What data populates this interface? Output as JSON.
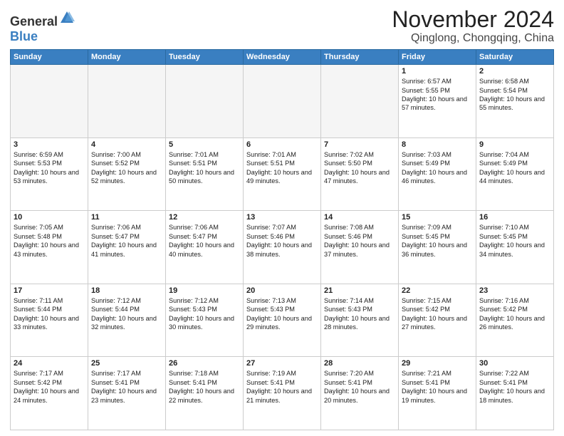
{
  "logo": {
    "general": "General",
    "blue": "Blue"
  },
  "title": "November 2024",
  "location": "Qinglong, Chongqing, China",
  "days_header": [
    "Sunday",
    "Monday",
    "Tuesday",
    "Wednesday",
    "Thursday",
    "Friday",
    "Saturday"
  ],
  "weeks": [
    [
      {
        "day": "",
        "empty": true
      },
      {
        "day": "",
        "empty": true
      },
      {
        "day": "",
        "empty": true
      },
      {
        "day": "",
        "empty": true
      },
      {
        "day": "",
        "empty": true
      },
      {
        "day": "1",
        "text": "Sunrise: 6:57 AM\nSunset: 5:55 PM\nDaylight: 10 hours and 57 minutes."
      },
      {
        "day": "2",
        "text": "Sunrise: 6:58 AM\nSunset: 5:54 PM\nDaylight: 10 hours and 55 minutes."
      }
    ],
    [
      {
        "day": "3",
        "text": "Sunrise: 6:59 AM\nSunset: 5:53 PM\nDaylight: 10 hours and 53 minutes."
      },
      {
        "day": "4",
        "text": "Sunrise: 7:00 AM\nSunset: 5:52 PM\nDaylight: 10 hours and 52 minutes."
      },
      {
        "day": "5",
        "text": "Sunrise: 7:01 AM\nSunset: 5:51 PM\nDaylight: 10 hours and 50 minutes."
      },
      {
        "day": "6",
        "text": "Sunrise: 7:01 AM\nSunset: 5:51 PM\nDaylight: 10 hours and 49 minutes."
      },
      {
        "day": "7",
        "text": "Sunrise: 7:02 AM\nSunset: 5:50 PM\nDaylight: 10 hours and 47 minutes."
      },
      {
        "day": "8",
        "text": "Sunrise: 7:03 AM\nSunset: 5:49 PM\nDaylight: 10 hours and 46 minutes."
      },
      {
        "day": "9",
        "text": "Sunrise: 7:04 AM\nSunset: 5:49 PM\nDaylight: 10 hours and 44 minutes."
      }
    ],
    [
      {
        "day": "10",
        "text": "Sunrise: 7:05 AM\nSunset: 5:48 PM\nDaylight: 10 hours and 43 minutes."
      },
      {
        "day": "11",
        "text": "Sunrise: 7:06 AM\nSunset: 5:47 PM\nDaylight: 10 hours and 41 minutes."
      },
      {
        "day": "12",
        "text": "Sunrise: 7:06 AM\nSunset: 5:47 PM\nDaylight: 10 hours and 40 minutes."
      },
      {
        "day": "13",
        "text": "Sunrise: 7:07 AM\nSunset: 5:46 PM\nDaylight: 10 hours and 38 minutes."
      },
      {
        "day": "14",
        "text": "Sunrise: 7:08 AM\nSunset: 5:46 PM\nDaylight: 10 hours and 37 minutes."
      },
      {
        "day": "15",
        "text": "Sunrise: 7:09 AM\nSunset: 5:45 PM\nDaylight: 10 hours and 36 minutes."
      },
      {
        "day": "16",
        "text": "Sunrise: 7:10 AM\nSunset: 5:45 PM\nDaylight: 10 hours and 34 minutes."
      }
    ],
    [
      {
        "day": "17",
        "text": "Sunrise: 7:11 AM\nSunset: 5:44 PM\nDaylight: 10 hours and 33 minutes."
      },
      {
        "day": "18",
        "text": "Sunrise: 7:12 AM\nSunset: 5:44 PM\nDaylight: 10 hours and 32 minutes."
      },
      {
        "day": "19",
        "text": "Sunrise: 7:12 AM\nSunset: 5:43 PM\nDaylight: 10 hours and 30 minutes."
      },
      {
        "day": "20",
        "text": "Sunrise: 7:13 AM\nSunset: 5:43 PM\nDaylight: 10 hours and 29 minutes."
      },
      {
        "day": "21",
        "text": "Sunrise: 7:14 AM\nSunset: 5:43 PM\nDaylight: 10 hours and 28 minutes."
      },
      {
        "day": "22",
        "text": "Sunrise: 7:15 AM\nSunset: 5:42 PM\nDaylight: 10 hours and 27 minutes."
      },
      {
        "day": "23",
        "text": "Sunrise: 7:16 AM\nSunset: 5:42 PM\nDaylight: 10 hours and 26 minutes."
      }
    ],
    [
      {
        "day": "24",
        "text": "Sunrise: 7:17 AM\nSunset: 5:42 PM\nDaylight: 10 hours and 24 minutes."
      },
      {
        "day": "25",
        "text": "Sunrise: 7:17 AM\nSunset: 5:41 PM\nDaylight: 10 hours and 23 minutes."
      },
      {
        "day": "26",
        "text": "Sunrise: 7:18 AM\nSunset: 5:41 PM\nDaylight: 10 hours and 22 minutes."
      },
      {
        "day": "27",
        "text": "Sunrise: 7:19 AM\nSunset: 5:41 PM\nDaylight: 10 hours and 21 minutes."
      },
      {
        "day": "28",
        "text": "Sunrise: 7:20 AM\nSunset: 5:41 PM\nDaylight: 10 hours and 20 minutes."
      },
      {
        "day": "29",
        "text": "Sunrise: 7:21 AM\nSunset: 5:41 PM\nDaylight: 10 hours and 19 minutes."
      },
      {
        "day": "30",
        "text": "Sunrise: 7:22 AM\nSunset: 5:41 PM\nDaylight: 10 hours and 18 minutes."
      }
    ]
  ]
}
